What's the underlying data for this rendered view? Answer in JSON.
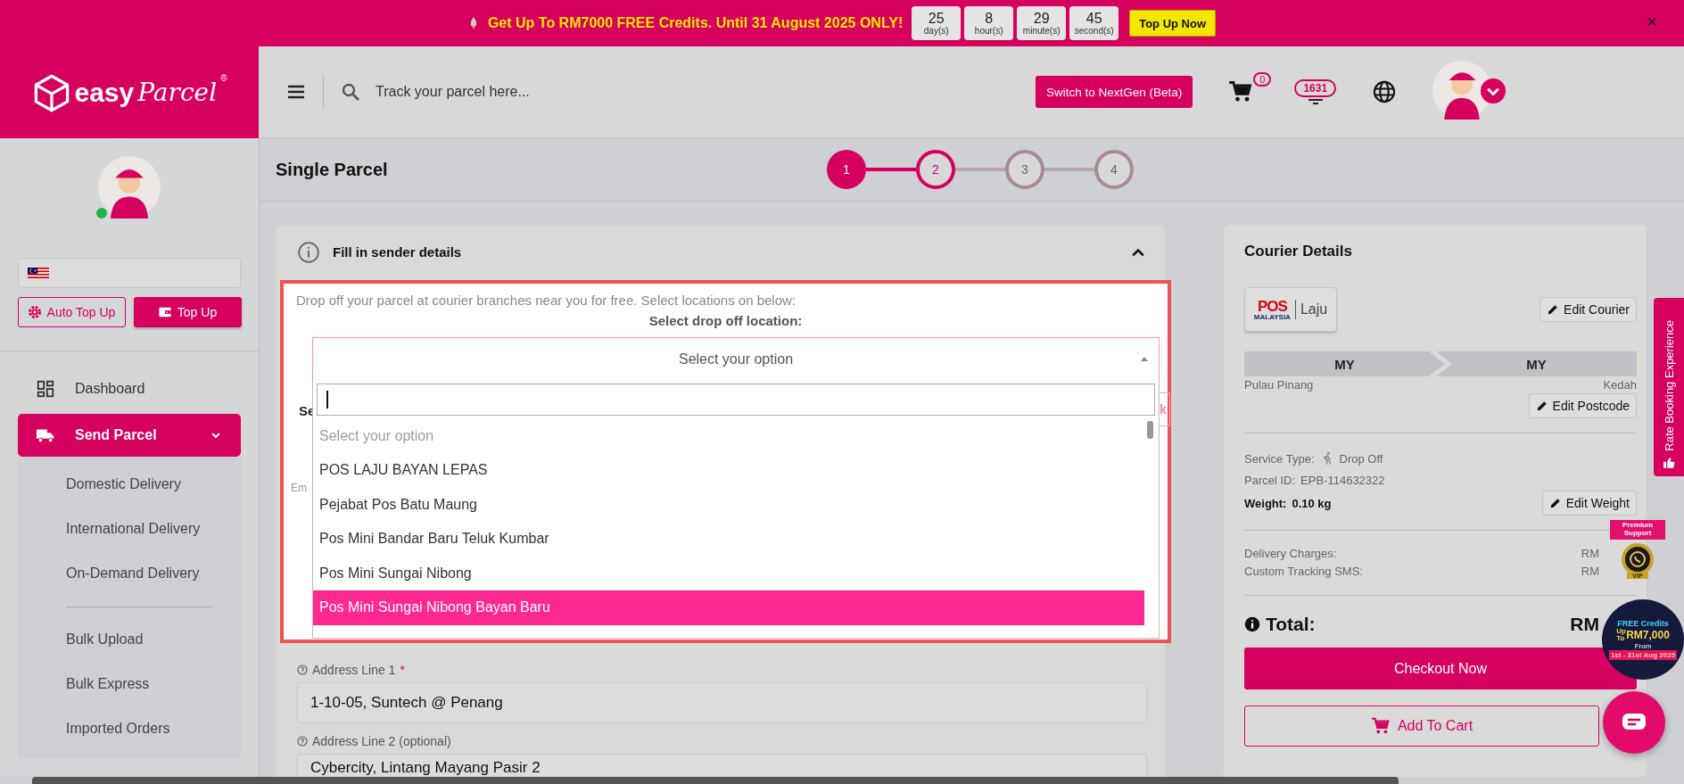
{
  "promo_banner": {
    "message": "Get Up To RM7000 FREE Credits. Until 31 August 2025 ONLY!",
    "countdown": [
      {
        "value": "25",
        "unit": "day(s)"
      },
      {
        "value": "8",
        "unit": "hour(s)"
      },
      {
        "value": "29",
        "unit": "minute(s)"
      },
      {
        "value": "45",
        "unit": "second(s)"
      }
    ],
    "button": "Top Up Now",
    "close": "×"
  },
  "header": {
    "logo_text": "easy",
    "logo_script": "Parcel",
    "logo_mark": "®",
    "search_placeholder": "Track your parcel here...",
    "switch_button": "Switch to NextGen (Beta)",
    "cart_count": "0",
    "notification_count": "1631"
  },
  "sidebar": {
    "online": true,
    "buttons": [
      {
        "label": "Auto Top Up",
        "kind": "outline"
      },
      {
        "label": "Top Up",
        "kind": "solid"
      }
    ],
    "nav": [
      {
        "label": "Dashboard",
        "selected": false
      },
      {
        "label": "Send Parcel",
        "selected": true,
        "expanded": true,
        "children": [
          {
            "label": "Domestic Delivery",
            "separator_before": false
          },
          {
            "label": "International Delivery",
            "separator_before": false
          },
          {
            "label": "On-Demand Delivery",
            "separator_before": false
          },
          {
            "label": "Bulk Upload",
            "separator_before": true
          },
          {
            "label": "Bulk Express",
            "separator_before": false
          },
          {
            "label": "Imported Orders",
            "separator_before": false
          }
        ]
      }
    ]
  },
  "page": {
    "title": "Single Parcel",
    "steps": [
      {
        "label": "1",
        "done": true,
        "current": false
      },
      {
        "label": "2",
        "done": false,
        "current": true
      },
      {
        "label": "3",
        "done": false,
        "current": false
      },
      {
        "label": "4",
        "done": false,
        "current": false
      }
    ]
  },
  "sender_section": {
    "title": "Fill in sender details",
    "expanded": true,
    "dropoff": {
      "note": "Drop off your parcel at courier branches near you for free. Select locations on below:",
      "label": "Select drop off location:",
      "placeholder": "Select your option",
      "open": true,
      "options": [
        {
          "label": "Select your option",
          "kind": "placeholder",
          "highlighted": false
        },
        {
          "label": "POS LAJU BAYAN LEPAS",
          "kind": "option",
          "highlighted": false
        },
        {
          "label": "Pejabat Pos Batu Maung",
          "kind": "option",
          "highlighted": false
        },
        {
          "label": "Pos Mini Bandar Baru Teluk Kumbar",
          "kind": "option",
          "highlighted": false
        },
        {
          "label": "Pos Mini Sungai Nibong",
          "kind": "option",
          "highlighted": false
        },
        {
          "label": "Pos Mini Sungai Nibong Bayan Baru",
          "kind": "option",
          "highlighted": true
        }
      ]
    },
    "hidden_fragments": {
      "heading": "Se",
      "button": "k",
      "label": "Em"
    },
    "fields": [
      {
        "label": "Address Line 1",
        "required_mark": "*",
        "value": "1-10-05, Suntech @ Penang"
      },
      {
        "label": "Address Line 2 (optional)",
        "value": "Cybercity, Lintang Mayang Pasir 2"
      }
    ]
  },
  "courier": {
    "title": "Courier Details",
    "logo_brand": "POS",
    "logo_sub": "MALAYSIA",
    "logo_service": "Laju",
    "edit_courier": "Edit Courier",
    "route": {
      "from_country": "MY",
      "to_country": "MY",
      "from_state": "Pulau Pinang",
      "to_state": "Kedah"
    },
    "edit_postcode": "Edit Postcode",
    "service_type": {
      "label": "Service Type:",
      "value": "Drop Off"
    },
    "parcel_id": {
      "label": "Parcel ID:",
      "value": "EPB-114632322"
    },
    "weight": {
      "label": "Weight:",
      "value": "0.10 kg"
    },
    "edit_weight": "Edit Weight",
    "charges": [
      {
        "label": "Delivery Charges:",
        "value": "RM"
      },
      {
        "label": "Custom Tracking SMS:",
        "value": "RM"
      }
    ],
    "total": {
      "label": "Total:",
      "value": "RM"
    },
    "checkout": "Checkout Now",
    "add_to_cart": "Add To Cart"
  },
  "side_tab": "Rate Booking Experience",
  "premium_badge": {
    "title": "Premium Support",
    "tag": "VIP"
  },
  "credits_badge": {
    "title": "FREE Credits",
    "prefix": "Up To",
    "amount": "RM7,000",
    "from": "From",
    "period": "1st - 31st Aug 2025"
  }
}
